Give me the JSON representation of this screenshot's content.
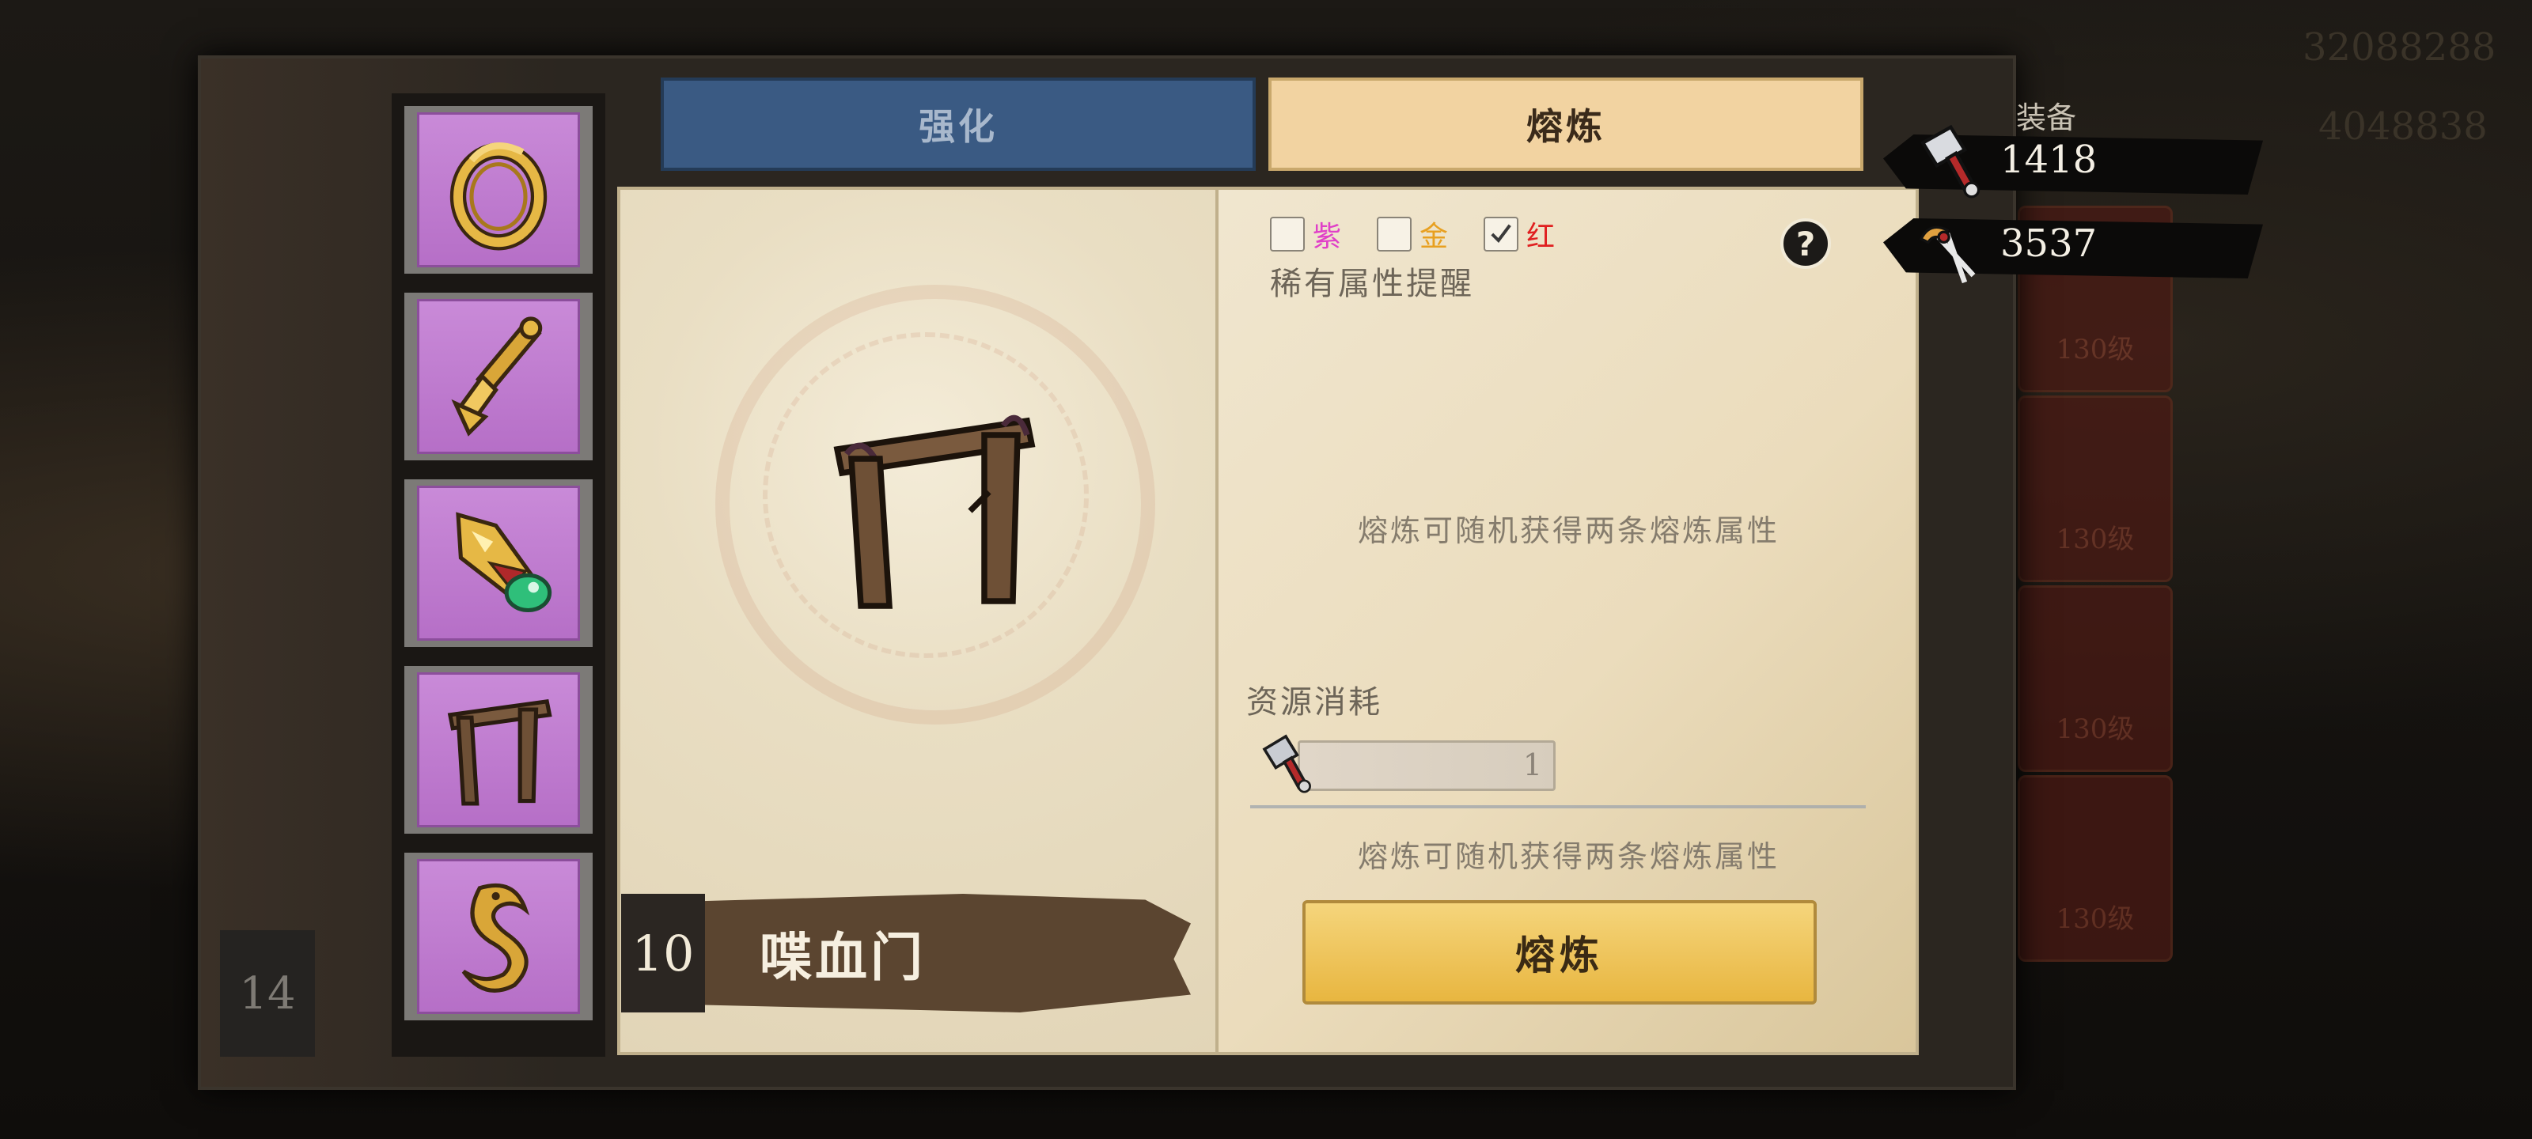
{
  "tabs": {
    "enhance": "强化",
    "smelt": "熔炼"
  },
  "currencies": [
    {
      "icon": "hammer-icon",
      "value": "1418"
    },
    {
      "icon": "tongs-icon",
      "value": "3537"
    }
  ],
  "background": {
    "score_top": "32088288",
    "score_second": "4048838",
    "equip_label": "装备",
    "card_levels": [
      "130级",
      "130级",
      "130级",
      "130级"
    ],
    "side_level": "14"
  },
  "item_list": [
    {
      "name": "ring-item",
      "icon": "ring-icon"
    },
    {
      "name": "pendant-item",
      "icon": "pendant-icon"
    },
    {
      "name": "talisman-item",
      "icon": "talisman-icon"
    },
    {
      "name": "gate-item",
      "icon": "wooden-gate-icon"
    },
    {
      "name": "hook-item",
      "icon": "hook-icon"
    }
  ],
  "selected_item": {
    "level": "10",
    "name": "喋血门"
  },
  "filters": {
    "options": [
      {
        "label": "紫",
        "color": "#e040c8",
        "checked": false
      },
      {
        "label": "金",
        "color": "#e8a020",
        "checked": false
      },
      {
        "label": "红",
        "color": "#e02020",
        "checked": true
      }
    ],
    "caption": "稀有属性提醒"
  },
  "help_symbol": "?",
  "smelt_hint_top": "熔炼可随机获得两条熔炼属性",
  "resource": {
    "label": "资源消耗",
    "amount": "1"
  },
  "smelt_hint_bottom": "熔炼可随机获得两条熔炼属性",
  "smelt_button": "熔炼",
  "colors": {
    "accent_gold": "#e8b640",
    "tab_blue": "#3a5a83",
    "tab_cream": "#f2d3a1",
    "item_purple": "#b66fc7"
  }
}
